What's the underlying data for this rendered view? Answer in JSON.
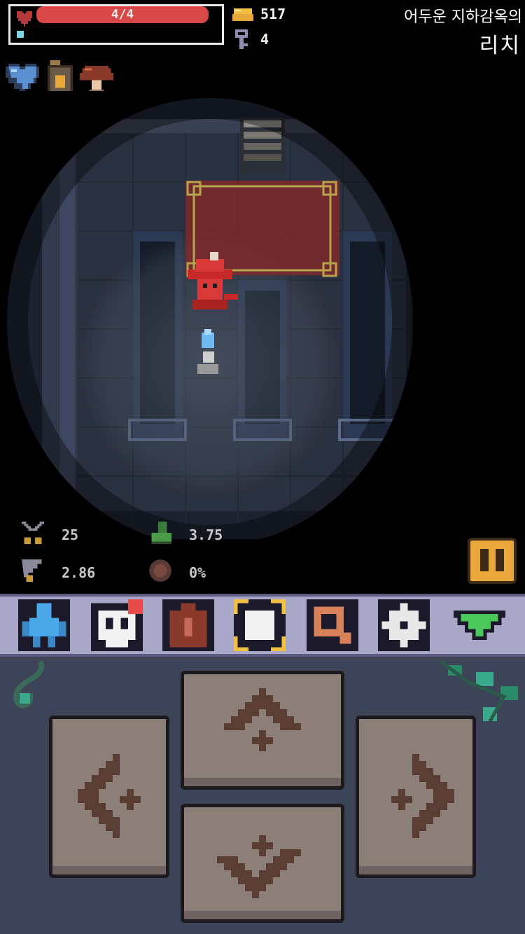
{
  "hud": {
    "hp_text": "4/4",
    "hp_fraction": 1.0,
    "gold": "517",
    "keys": "4",
    "dungeon_name": "어두운 지하감옥의",
    "floor_name": "리치"
  },
  "status_effects": [
    {
      "icon": "blue-heart-icon"
    },
    {
      "icon": "lantern-icon"
    },
    {
      "icon": "mushroom-icon"
    }
  ],
  "stats": {
    "attack": "25",
    "speed": "3.75",
    "attack_speed": "2.86",
    "crit": "0%"
  },
  "toolbar": [
    {
      "icon": "character-icon"
    },
    {
      "icon": "skull-icon",
      "badge": true
    },
    {
      "icon": "backpack-icon"
    },
    {
      "icon": "map-icon"
    },
    {
      "icon": "magnifier-icon"
    },
    {
      "icon": "gear-icon"
    },
    {
      "icon": "collapse-triangle-icon"
    }
  ],
  "dpad": [
    "up",
    "left",
    "right",
    "down"
  ],
  "colors": {
    "hp_red": "#d94848",
    "gold": "#e8a73a",
    "toolbar_bg": "#a9a7c7",
    "pad_bg": "#3d4457",
    "button_face": "#8b7f78"
  }
}
